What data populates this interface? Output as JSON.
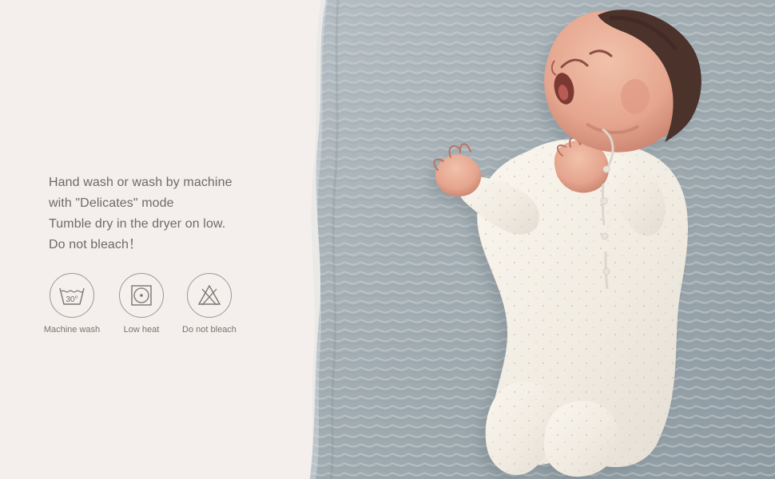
{
  "care_instructions": {
    "lines": [
      "Hand wash or wash by machine",
      "with \"Delicates\" mode",
      "Tumble dry in the dryer on low.",
      "Do not bleach！"
    ]
  },
  "care_icons": [
    {
      "icon": "machine-wash-30-icon",
      "symbol": "30°",
      "label": "Machine wash"
    },
    {
      "icon": "low-heat-tumble-dry-icon",
      "label": "Low heat"
    },
    {
      "icon": "do-not-bleach-icon",
      "label": "Do not bleach"
    }
  ],
  "colors": {
    "background": "#f4efec",
    "text": "#6f6a67",
    "blanket": "#9eaab0",
    "onesie": "#f3efe6"
  }
}
